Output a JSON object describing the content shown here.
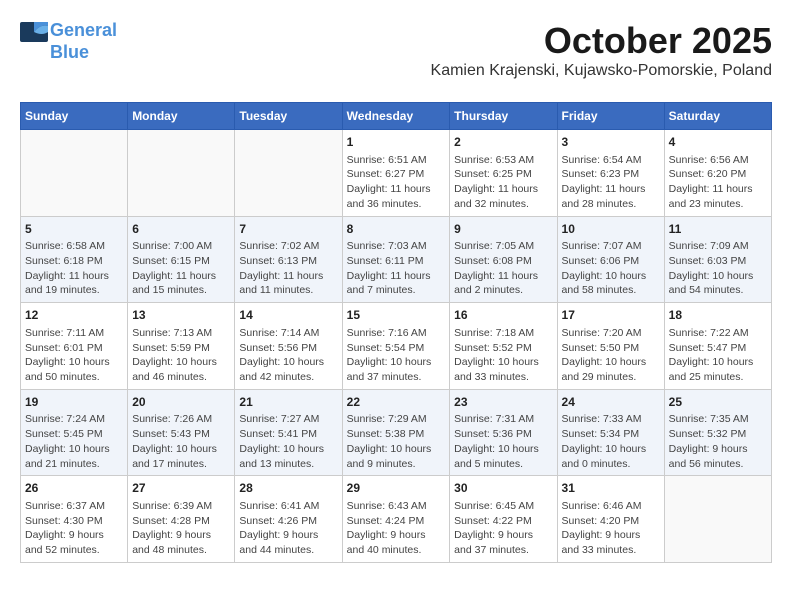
{
  "header": {
    "logo_line1": "General",
    "logo_line2": "Blue",
    "month_title": "October 2025",
    "location": "Kamien Krajenski, Kujawsko-Pomorskie, Poland"
  },
  "weekdays": [
    "Sunday",
    "Monday",
    "Tuesday",
    "Wednesday",
    "Thursday",
    "Friday",
    "Saturday"
  ],
  "weeks": [
    [
      {
        "day": "",
        "info": ""
      },
      {
        "day": "",
        "info": ""
      },
      {
        "day": "",
        "info": ""
      },
      {
        "day": "1",
        "info": "Sunrise: 6:51 AM\nSunset: 6:27 PM\nDaylight: 11 hours\nand 36 minutes."
      },
      {
        "day": "2",
        "info": "Sunrise: 6:53 AM\nSunset: 6:25 PM\nDaylight: 11 hours\nand 32 minutes."
      },
      {
        "day": "3",
        "info": "Sunrise: 6:54 AM\nSunset: 6:23 PM\nDaylight: 11 hours\nand 28 minutes."
      },
      {
        "day": "4",
        "info": "Sunrise: 6:56 AM\nSunset: 6:20 PM\nDaylight: 11 hours\nand 23 minutes."
      }
    ],
    [
      {
        "day": "5",
        "info": "Sunrise: 6:58 AM\nSunset: 6:18 PM\nDaylight: 11 hours\nand 19 minutes."
      },
      {
        "day": "6",
        "info": "Sunrise: 7:00 AM\nSunset: 6:15 PM\nDaylight: 11 hours\nand 15 minutes."
      },
      {
        "day": "7",
        "info": "Sunrise: 7:02 AM\nSunset: 6:13 PM\nDaylight: 11 hours\nand 11 minutes."
      },
      {
        "day": "8",
        "info": "Sunrise: 7:03 AM\nSunset: 6:11 PM\nDaylight: 11 hours\nand 7 minutes."
      },
      {
        "day": "9",
        "info": "Sunrise: 7:05 AM\nSunset: 6:08 PM\nDaylight: 11 hours\nand 2 minutes."
      },
      {
        "day": "10",
        "info": "Sunrise: 7:07 AM\nSunset: 6:06 PM\nDaylight: 10 hours\nand 58 minutes."
      },
      {
        "day": "11",
        "info": "Sunrise: 7:09 AM\nSunset: 6:03 PM\nDaylight: 10 hours\nand 54 minutes."
      }
    ],
    [
      {
        "day": "12",
        "info": "Sunrise: 7:11 AM\nSunset: 6:01 PM\nDaylight: 10 hours\nand 50 minutes."
      },
      {
        "day": "13",
        "info": "Sunrise: 7:13 AM\nSunset: 5:59 PM\nDaylight: 10 hours\nand 46 minutes."
      },
      {
        "day": "14",
        "info": "Sunrise: 7:14 AM\nSunset: 5:56 PM\nDaylight: 10 hours\nand 42 minutes."
      },
      {
        "day": "15",
        "info": "Sunrise: 7:16 AM\nSunset: 5:54 PM\nDaylight: 10 hours\nand 37 minutes."
      },
      {
        "day": "16",
        "info": "Sunrise: 7:18 AM\nSunset: 5:52 PM\nDaylight: 10 hours\nand 33 minutes."
      },
      {
        "day": "17",
        "info": "Sunrise: 7:20 AM\nSunset: 5:50 PM\nDaylight: 10 hours\nand 29 minutes."
      },
      {
        "day": "18",
        "info": "Sunrise: 7:22 AM\nSunset: 5:47 PM\nDaylight: 10 hours\nand 25 minutes."
      }
    ],
    [
      {
        "day": "19",
        "info": "Sunrise: 7:24 AM\nSunset: 5:45 PM\nDaylight: 10 hours\nand 21 minutes."
      },
      {
        "day": "20",
        "info": "Sunrise: 7:26 AM\nSunset: 5:43 PM\nDaylight: 10 hours\nand 17 minutes."
      },
      {
        "day": "21",
        "info": "Sunrise: 7:27 AM\nSunset: 5:41 PM\nDaylight: 10 hours\nand 13 minutes."
      },
      {
        "day": "22",
        "info": "Sunrise: 7:29 AM\nSunset: 5:38 PM\nDaylight: 10 hours\nand 9 minutes."
      },
      {
        "day": "23",
        "info": "Sunrise: 7:31 AM\nSunset: 5:36 PM\nDaylight: 10 hours\nand 5 minutes."
      },
      {
        "day": "24",
        "info": "Sunrise: 7:33 AM\nSunset: 5:34 PM\nDaylight: 10 hours\nand 0 minutes."
      },
      {
        "day": "25",
        "info": "Sunrise: 7:35 AM\nSunset: 5:32 PM\nDaylight: 9 hours\nand 56 minutes."
      }
    ],
    [
      {
        "day": "26",
        "info": "Sunrise: 6:37 AM\nSunset: 4:30 PM\nDaylight: 9 hours\nand 52 minutes."
      },
      {
        "day": "27",
        "info": "Sunrise: 6:39 AM\nSunset: 4:28 PM\nDaylight: 9 hours\nand 48 minutes."
      },
      {
        "day": "28",
        "info": "Sunrise: 6:41 AM\nSunset: 4:26 PM\nDaylight: 9 hours\nand 44 minutes."
      },
      {
        "day": "29",
        "info": "Sunrise: 6:43 AM\nSunset: 4:24 PM\nDaylight: 9 hours\nand 40 minutes."
      },
      {
        "day": "30",
        "info": "Sunrise: 6:45 AM\nSunset: 4:22 PM\nDaylight: 9 hours\nand 37 minutes."
      },
      {
        "day": "31",
        "info": "Sunrise: 6:46 AM\nSunset: 4:20 PM\nDaylight: 9 hours\nand 33 minutes."
      },
      {
        "day": "",
        "info": ""
      }
    ]
  ]
}
